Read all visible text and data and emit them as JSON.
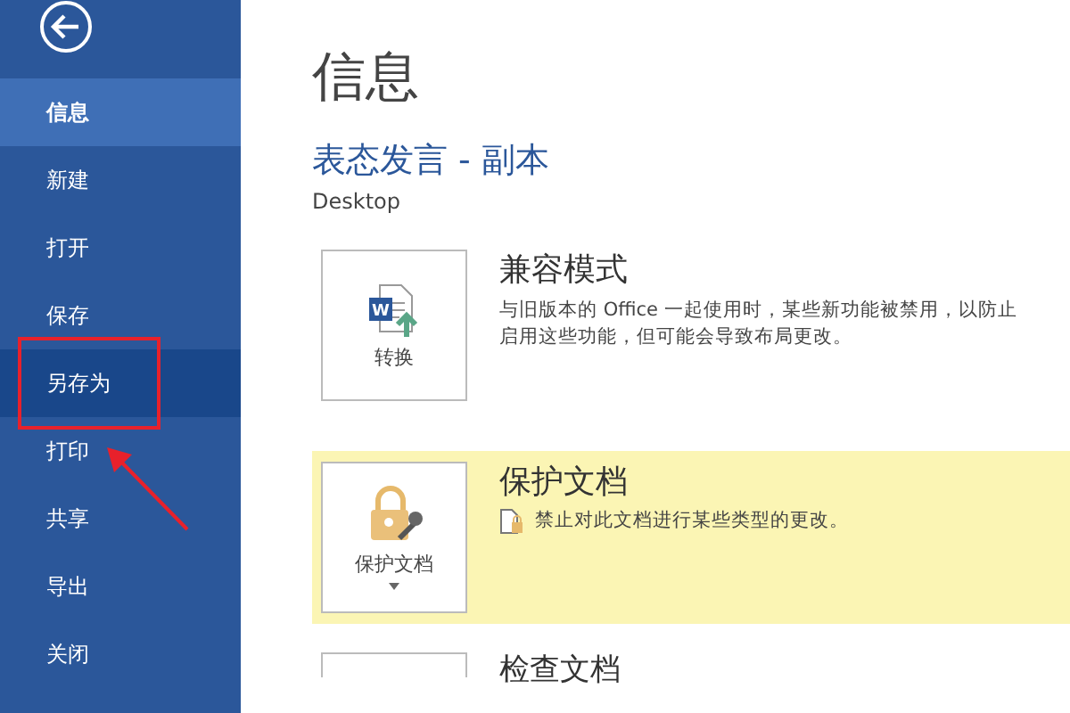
{
  "sidebar": {
    "items": [
      {
        "label": "信息",
        "selected": true,
        "hovered": false
      },
      {
        "label": "新建",
        "selected": false,
        "hovered": false
      },
      {
        "label": "打开",
        "selected": false,
        "hovered": false
      },
      {
        "label": "保存",
        "selected": false,
        "hovered": false
      },
      {
        "label": "另存为",
        "selected": false,
        "hovered": true
      },
      {
        "label": "打印",
        "selected": false,
        "hovered": false
      },
      {
        "label": "共享",
        "selected": false,
        "hovered": false
      },
      {
        "label": "导出",
        "selected": false,
        "hovered": false
      },
      {
        "label": "关闭",
        "selected": false,
        "hovered": false
      }
    ]
  },
  "page_title": "信息",
  "document_name": "表态发言 - 副本",
  "location": "Desktop",
  "sections": [
    {
      "kind": "convert",
      "icon_letter": "W",
      "button": "转换",
      "title": "兼容模式",
      "description": "与旧版本的 Office 一起使用时，某些新功能被禁用，以防止",
      "description_2": "启用这些功能，但可能会导致布局更改。",
      "highlighted": false
    },
    {
      "kind": "protect",
      "button": "保护文档",
      "title": "保护文档",
      "description": "禁止对此文档进行某些类型的更改。",
      "highlighted": true
    },
    {
      "kind": "inspect",
      "title": "检查文档",
      "highlighted": false
    }
  ]
}
